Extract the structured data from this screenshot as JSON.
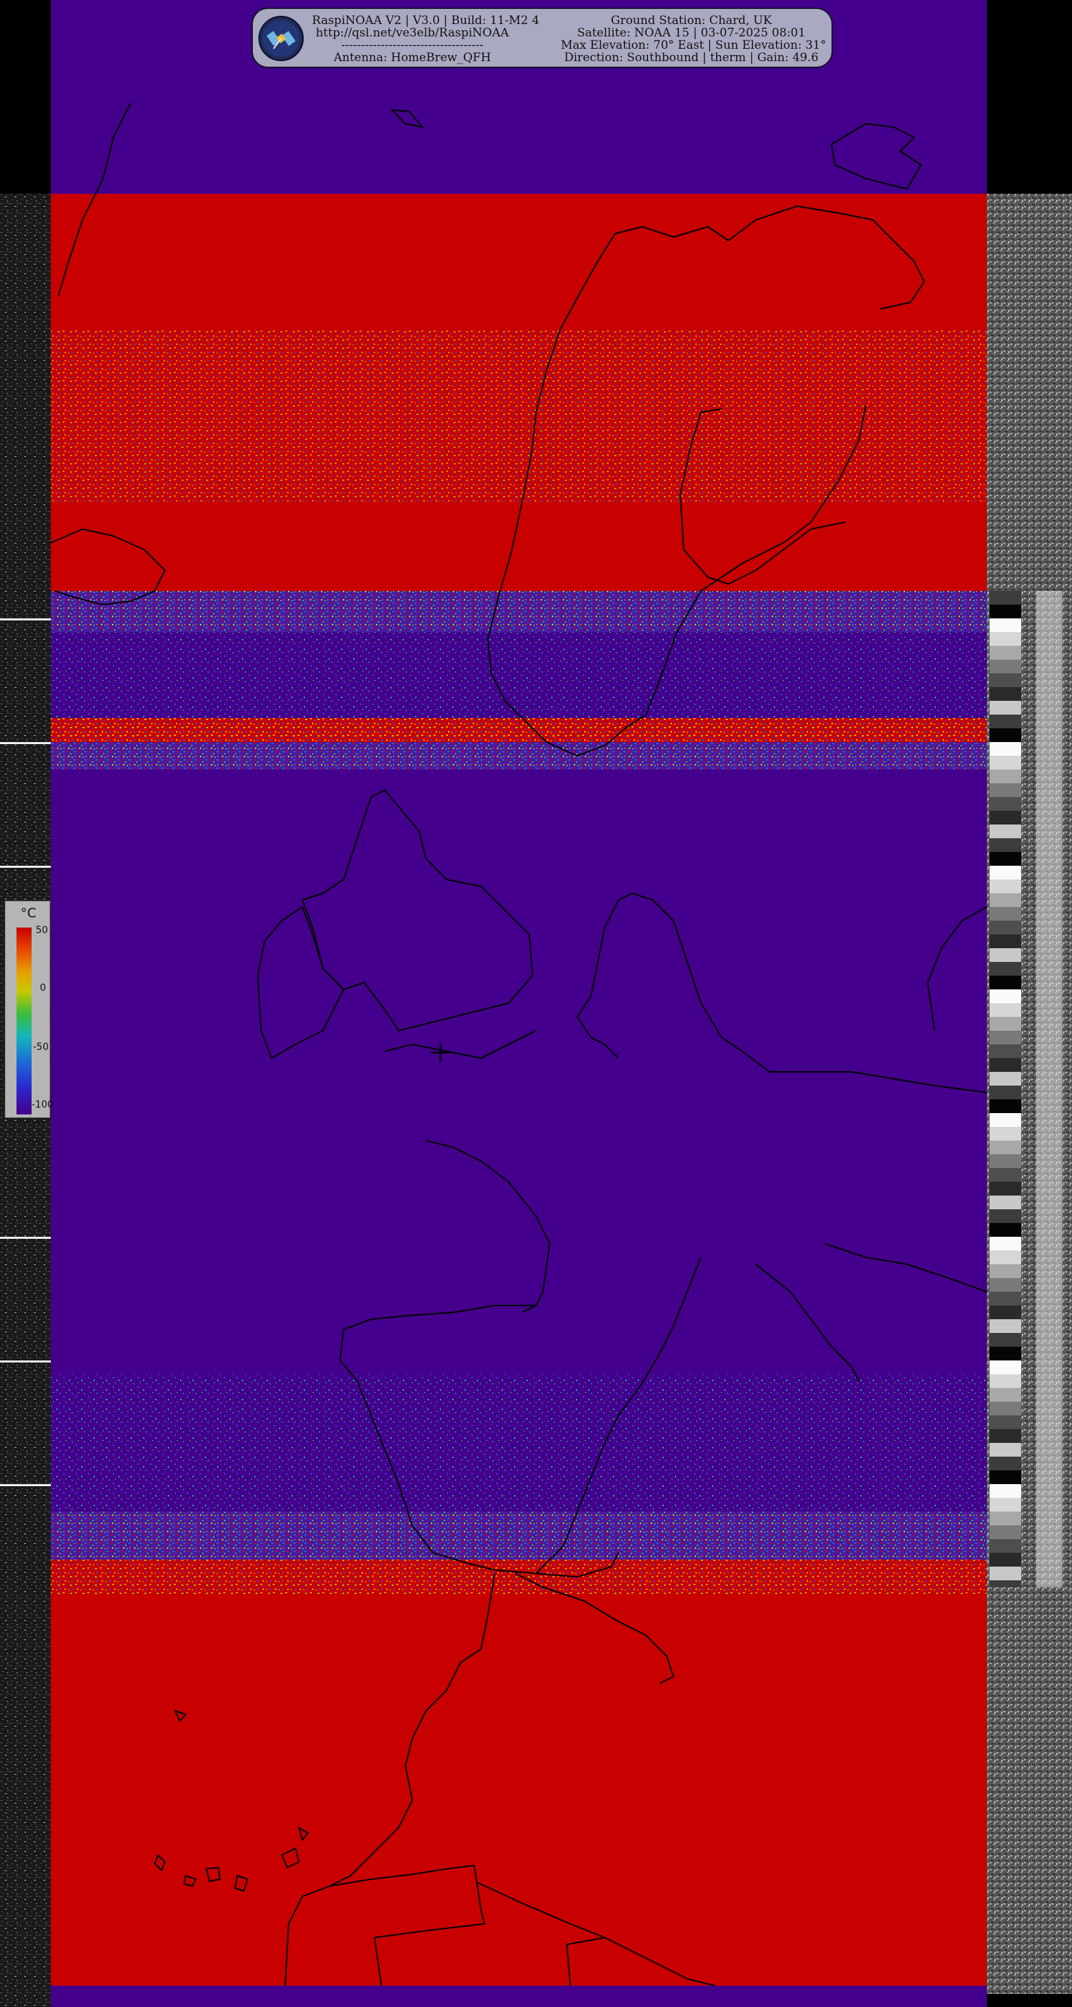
{
  "header": {
    "left_lines": [
      "RaspiNOAA V2 | V3.0 | Build: 11-M2 4",
      "http://qsl.net/ve3elb/RaspiNOAA",
      "------------------------------------",
      "Antenna: HomeBrew_QFH"
    ],
    "right_lines": [
      "Ground Station: Chard, UK",
      "Satellite: NOAA 15 | 03-07-2025 08:01",
      "Max Elevation: 70° East | Sun Elevation: 31°",
      "Direction: Southbound | therm | Gain: 49.6"
    ],
    "logo_icon": "satellite-icon"
  },
  "legend": {
    "unit": "°C",
    "ticks": [
      "50",
      "0",
      "-50",
      "-100"
    ]
  },
  "colors": {
    "cold_purple": "#44008c",
    "warm_red": "#c80000",
    "coastline": "#000000",
    "header_bg": "#a9a9c2"
  }
}
